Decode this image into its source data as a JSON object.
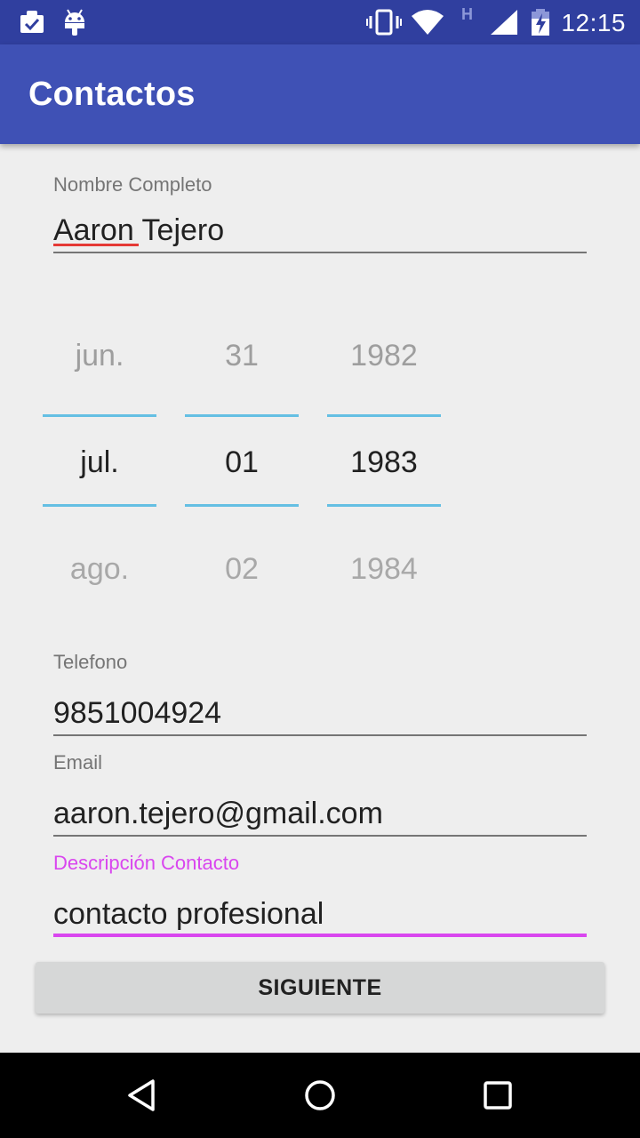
{
  "status_bar": {
    "time": "12:15",
    "network_type": "H",
    "icons": [
      "clipboard-check-icon",
      "android-icon",
      "vibrate-icon",
      "wifi-icon",
      "signal-icon",
      "battery-charging-icon"
    ]
  },
  "app_bar": {
    "title": "Contactos"
  },
  "form": {
    "nombre": {
      "label": "Nombre Completo",
      "value": "Aaron Tejero"
    },
    "fecha": {
      "months": {
        "prev": "jun.",
        "selected": "jul.",
        "next": "ago."
      },
      "days": {
        "prev": "31",
        "selected": "01",
        "next": "02"
      },
      "years": {
        "prev": "1982",
        "selected": "1983",
        "next": "1984"
      }
    },
    "telefono": {
      "label": "Telefono",
      "value": "9851004924"
    },
    "email": {
      "label": "Email",
      "value": "aaron.tejero@gmail.com"
    },
    "descripcion": {
      "label": "Descripción Contacto",
      "value": "contacto profesional"
    }
  },
  "button": {
    "label": "SIGUIENTE"
  },
  "nav_bar": {
    "icons": [
      "back-icon",
      "home-icon",
      "recents-icon"
    ]
  },
  "colors": {
    "status_bar": "#303f9f",
    "app_bar": "#3f51b5",
    "accent": "#d946ef",
    "picker_divider": "#64bfe3"
  }
}
